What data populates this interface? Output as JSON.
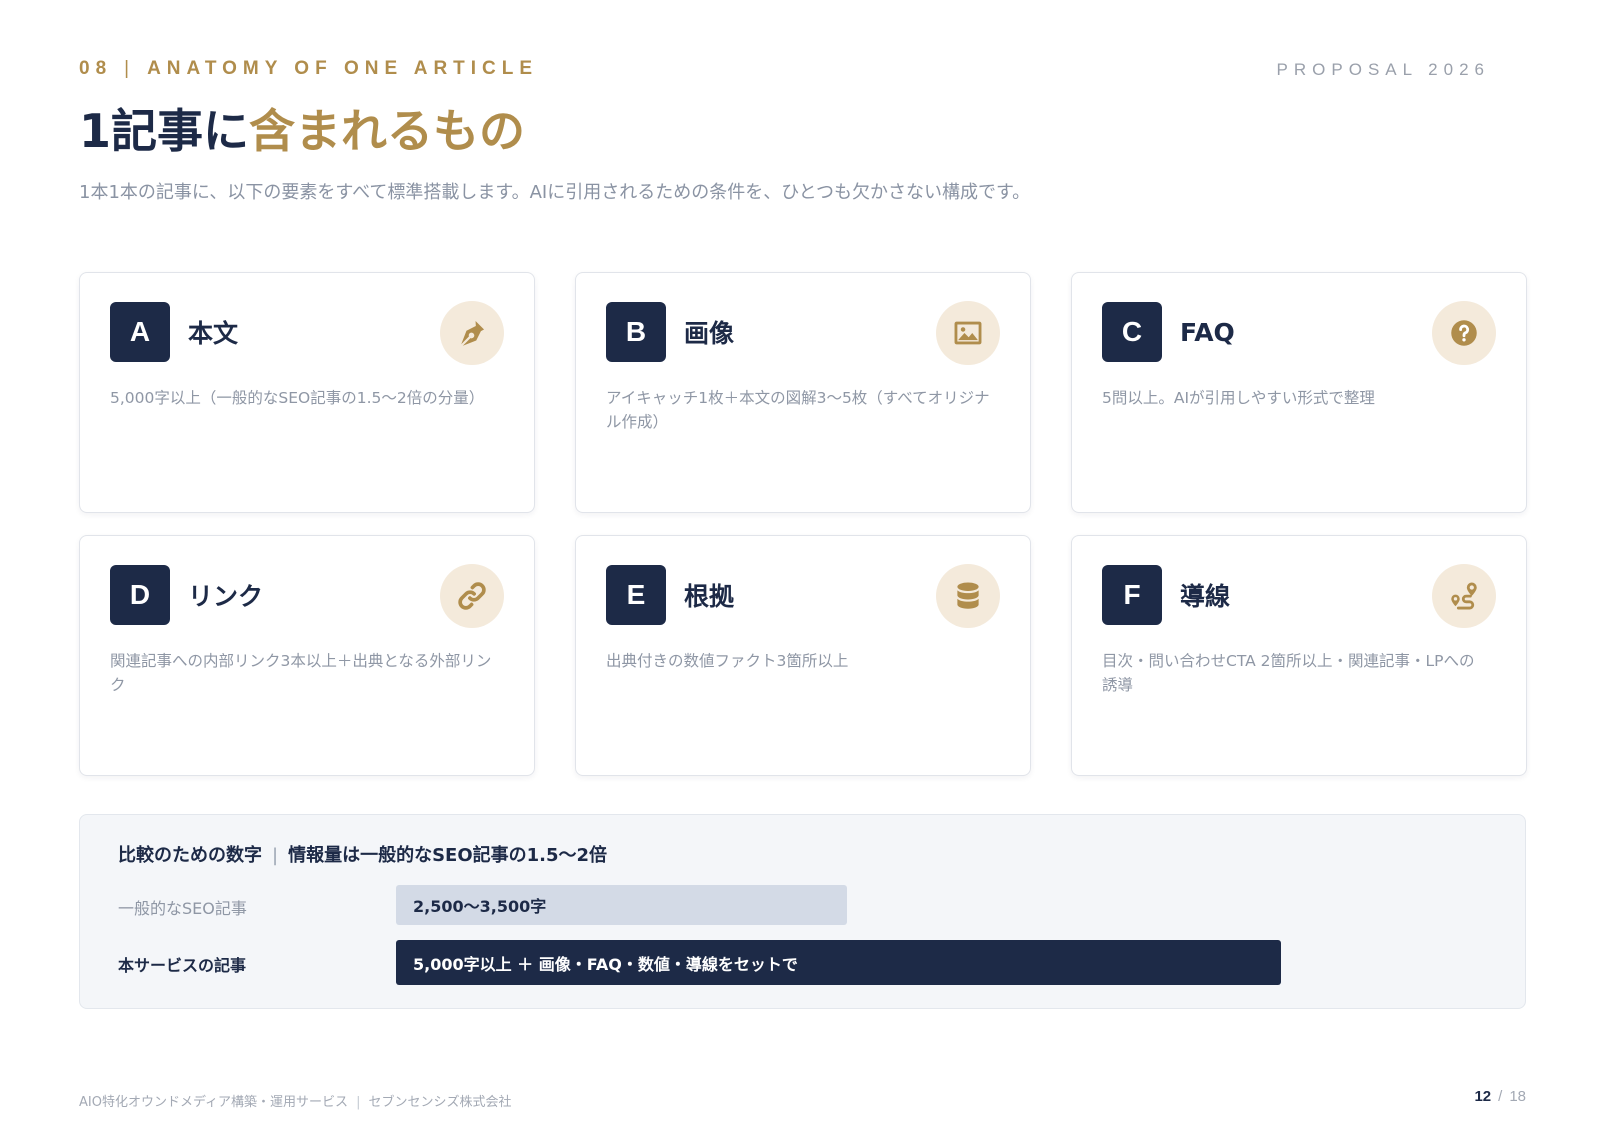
{
  "header": {
    "section_number": "08",
    "section_title": "ANATOMY OF ONE ARTICLE",
    "proposal_label": "PROPOSAL 2026",
    "title_main": "1記事に",
    "title_accent": "含まれるもの",
    "subtitle": "1本1本の記事に、以下の要素をすべて標準搭載します。AIに引用されるための条件を、ひとつも欠かさない構成です。"
  },
  "cards": [
    {
      "letter": "A",
      "title": "本文",
      "icon": "pen-nib-icon",
      "desc": "5,000字以上（一般的なSEO記事の1.5〜2倍の分量）"
    },
    {
      "letter": "B",
      "title": "画像",
      "icon": "image-icon",
      "desc": "アイキャッチ1枚＋本文の図解3〜5枚（すべてオリジナル作成）"
    },
    {
      "letter": "C",
      "title": "FAQ",
      "icon": "question-circle-icon",
      "desc": "5問以上。AIが引用しやすい形式で整理"
    },
    {
      "letter": "D",
      "title": "リンク",
      "icon": "link-icon",
      "desc": "関連記事への内部リンク3本以上＋出典となる外部リンク"
    },
    {
      "letter": "E",
      "title": "根拠",
      "icon": "database-icon",
      "desc": "出典付きの数値ファクト3箇所以上"
    },
    {
      "letter": "F",
      "title": "導線",
      "icon": "route-icon",
      "desc": "目次・問い合わせCTA 2箇所以上・関連記事・LPへの誘導"
    }
  ],
  "comparison": {
    "title": "比較のための数字",
    "separator": "|",
    "headline": "情報量は一般的なSEO記事の1.5〜2倍",
    "rows": [
      {
        "label": "一般的なSEO記事",
        "value": "2,500〜3,500字",
        "fraction": 0.51
      },
      {
        "label": "本サービスの記事",
        "value": "5,000字以上 ＋ 画像・FAQ・数値・導線をセットで",
        "fraction": 1.0
      }
    ]
  },
  "footer": {
    "service": "AIO特化オウンドメディア構築・運用サービス",
    "separator": "|",
    "company": "セブンセンシズ株式会社",
    "page_current": "12",
    "page_sep": "/",
    "page_total": "18"
  },
  "colors": {
    "navy": "#1d2a47",
    "gold": "#b08d4c",
    "icon_bg": "#f4eadb",
    "muted": "#8f97a5"
  }
}
